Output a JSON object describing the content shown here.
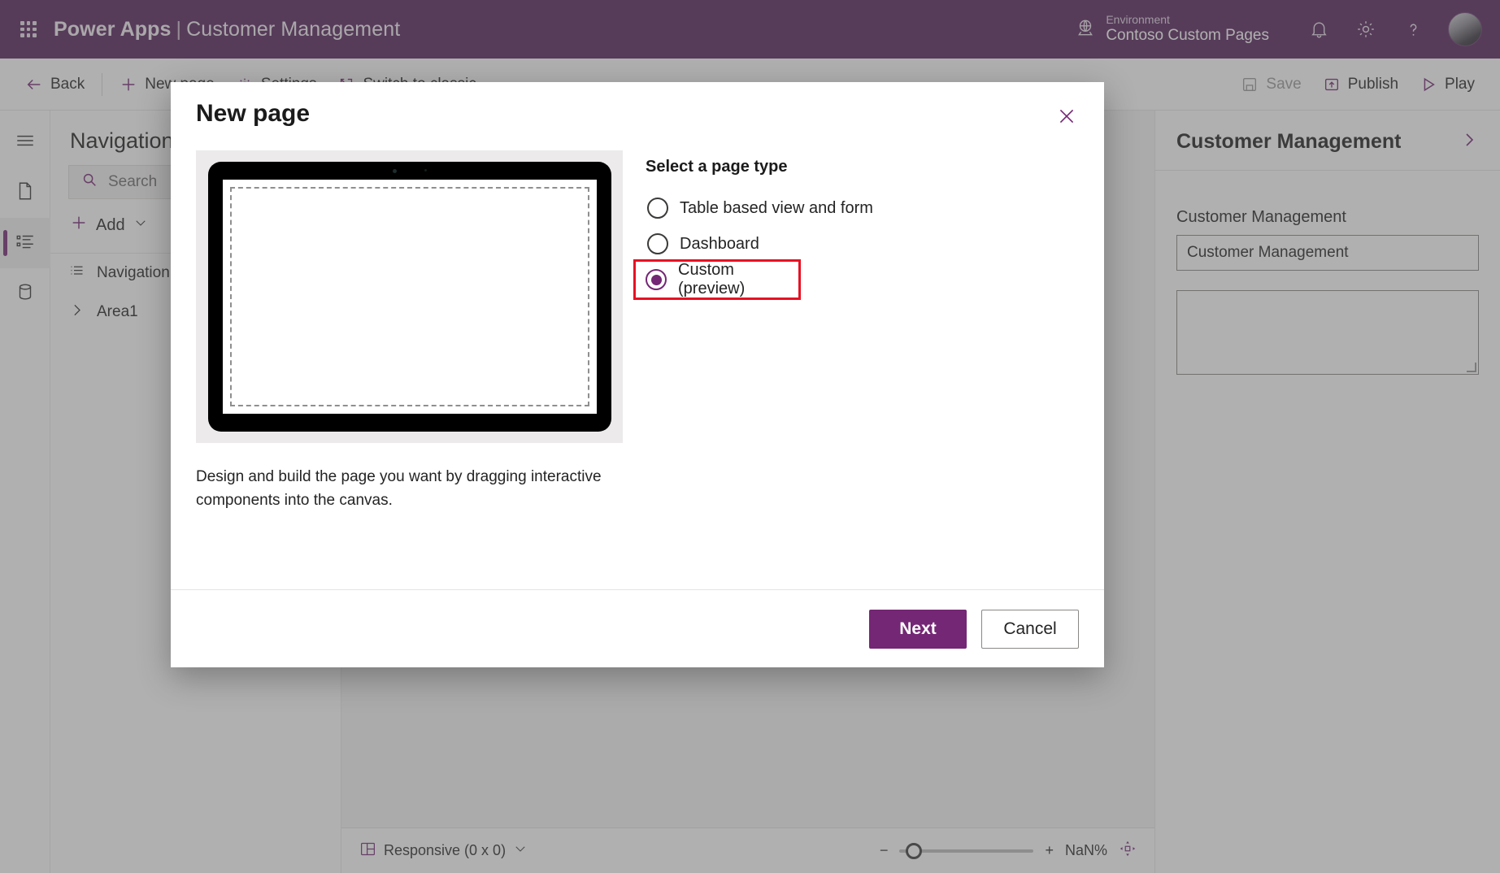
{
  "brand": {
    "waffle_icon": "app-launcher-icon",
    "product": "Power Apps",
    "separator": "|",
    "app_name": "Customer Management",
    "environment_label": "Environment",
    "environment_value": "Contoso Custom Pages",
    "globe_icon": "globe-icon",
    "notification_icon": "bell-icon",
    "settings_icon": "gear-icon",
    "help_icon": "question-mark-icon",
    "avatar": "user-avatar",
    "bar_color": "#55215A"
  },
  "commandbar": {
    "back": "Back",
    "new_page": "New page",
    "settings": "Settings",
    "switch_to_classic": "Switch to classic",
    "save": "Save",
    "publish": "Publish",
    "play": "Play"
  },
  "rail": {
    "items": [
      {
        "name": "hamburger-menu",
        "label": ""
      },
      {
        "name": "pages",
        "label": ""
      },
      {
        "name": "navigation",
        "label": ""
      },
      {
        "name": "data",
        "label": ""
      }
    ]
  },
  "navpane": {
    "title": "Navigation",
    "search_placeholder": "Search",
    "add_label": "Add",
    "tree": [
      {
        "label": "Navigation",
        "icon": "list-icon",
        "level": 0
      },
      {
        "label": "Area1",
        "icon": "chevron-right-icon",
        "level": 1
      }
    ]
  },
  "properties": {
    "header_title": "Customer Management",
    "header_chevron": "chevron-right-icon",
    "field_label": "Customer Management",
    "field_value": "Customer Management"
  },
  "statusbar": {
    "screen_size_icon": "responsive-layout-icon",
    "screen_size": "Responsive (0 x 0)",
    "chevron": "chevron-down-icon",
    "minus": "−",
    "plus": "+",
    "zoom_value": "NaN%",
    "fit_icon": "fit-to-screen-icon"
  },
  "dialog": {
    "title": "New page",
    "close_icon": "close-icon",
    "preview_description": "Design and build the page you want by dragging interactive components into the canvas.",
    "options_heading": "Select a page type",
    "options": [
      {
        "label": "Table based view and form",
        "selected": false,
        "highlighted": false
      },
      {
        "label": "Dashboard",
        "selected": false,
        "highlighted": false
      },
      {
        "label": "Custom (preview)",
        "selected": true,
        "highlighted": true
      }
    ],
    "primary_button": "Next",
    "secondary_button": "Cancel",
    "accent_color": "#742774",
    "highlight_color": "#E81123"
  }
}
